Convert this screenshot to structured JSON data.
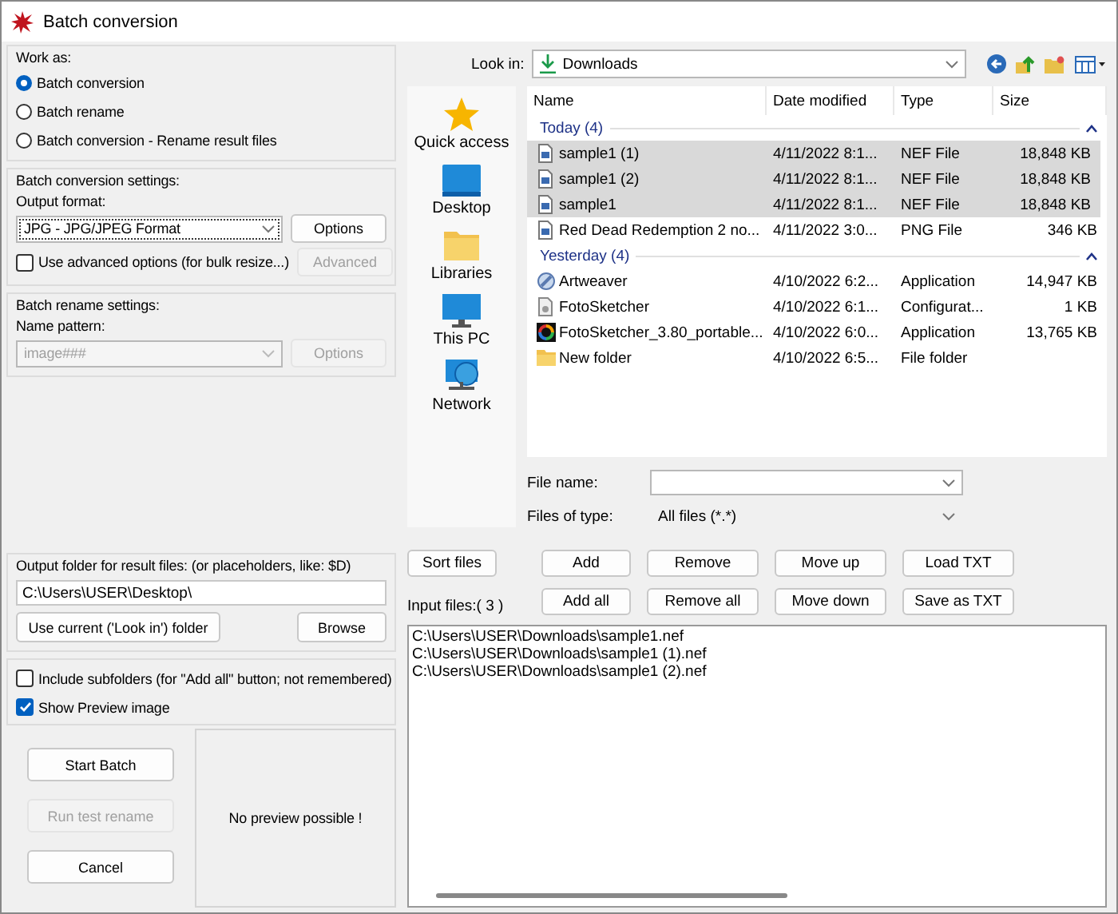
{
  "window": {
    "title": "Batch conversion"
  },
  "work_as": {
    "title": "Work as:",
    "options": [
      {
        "label": "Batch conversion",
        "selected": true
      },
      {
        "label": "Batch rename",
        "selected": false
      },
      {
        "label": "Batch conversion - Rename result files",
        "selected": false
      }
    ]
  },
  "conversion_settings": {
    "title": "Batch conversion settings:",
    "format_label": "Output format:",
    "format": "JPG - JPG/JPEG Format",
    "options_button": {
      "label": "Options",
      "disabled": false
    },
    "advanced_checkbox": {
      "label": "Use advanced options (for bulk resize...)",
      "checked": false
    },
    "advanced_button": {
      "label": "Advanced",
      "disabled": true
    }
  },
  "rename_settings": {
    "title": "Batch rename settings:",
    "pattern_label": "Name pattern:",
    "pattern": {
      "value": "image###",
      "disabled": true
    },
    "options_button": {
      "label": "Options",
      "disabled": true
    }
  },
  "output_folder": {
    "title": "Output folder for result files: (or placeholders, like: $D)",
    "value": "C:\\Users\\USER\\Desktop\\",
    "use_current_button": "Use current ('Look in') folder",
    "browse_button": "Browse"
  },
  "checkboxes": [
    {
      "label": "Include subfolders (for \"Add all\" button; not remembered)",
      "checked": false
    },
    {
      "label": "Show Preview image",
      "checked": true
    }
  ],
  "actions": [
    {
      "label": "Start Batch",
      "disabled": false
    },
    {
      "label": "Run test rename",
      "disabled": true
    },
    {
      "label": "Cancel",
      "disabled": false
    }
  ],
  "preview": {
    "text": "No preview possible !"
  },
  "file_browser": {
    "look_in_label": "Look in:",
    "look_in": "Downloads",
    "places": [
      {
        "label": "Quick access",
        "kind": "star"
      },
      {
        "label": "Desktop",
        "kind": "desktop"
      },
      {
        "label": "Libraries",
        "kind": "folder"
      },
      {
        "label": "This PC",
        "kind": "monitor"
      },
      {
        "label": "Network",
        "kind": "network"
      }
    ],
    "columns": [
      "Name",
      "Date modified",
      "Type",
      "Size"
    ],
    "groups": [
      {
        "title": "Today (4)",
        "expanded": true,
        "rows": [
          {
            "kind": "document",
            "name": "sample1 (1)",
            "date": "4/11/2022 8:1...",
            "type": "NEF File",
            "size": "18,848 KB",
            "selected": true
          },
          {
            "kind": "document",
            "name": "sample1 (2)",
            "date": "4/11/2022 8:1...",
            "type": "NEF File",
            "size": "18,848 KB",
            "selected": true
          },
          {
            "kind": "document",
            "name": "sample1",
            "date": "4/11/2022 8:1...",
            "type": "NEF File",
            "size": "18,848 KB",
            "selected": true
          },
          {
            "kind": "document",
            "name": "Red Dead Redemption 2 no...",
            "date": "4/11/2022 3:0...",
            "type": "PNG File",
            "size": "346 KB",
            "selected": false
          }
        ]
      },
      {
        "title": "Yesterday (4)",
        "expanded": true,
        "rows": [
          {
            "kind": "brush",
            "name": "Artweaver",
            "date": "4/10/2022 6:2...",
            "type": "Application",
            "size": "14,947 KB",
            "selected": false
          },
          {
            "kind": "settings",
            "name": "FotoSketcher",
            "date": "4/10/2022 6:1...",
            "type": "Configurat...",
            "size": "1 KB",
            "selected": false
          },
          {
            "kind": "swirl",
            "name": "FotoSketcher_3.80_portable...",
            "date": "4/10/2022 6:0...",
            "type": "Application",
            "size": "13,765 KB",
            "selected": false
          },
          {
            "kind": "folder",
            "name": "New folder",
            "date": "4/10/2022 6:5...",
            "type": "File folder",
            "selected": false
          }
        ]
      }
    ],
    "file_name_label": "File name:",
    "files_of_type_label": "Files of type:",
    "files_of_type": "All files (*.*)"
  },
  "sort_button": "Sort files",
  "list_buttons": [
    [
      "Add",
      "Remove",
      "Move up",
      "Load TXT"
    ],
    [
      "Add all",
      "Remove all",
      "Move down",
      "Save as TXT"
    ]
  ],
  "input_files_label": "Input files:( 3 )",
  "input_files": [
    "C:\\Users\\USER\\Downloads\\sample1.nef",
    "C:\\Users\\USER\\Downloads\\sample1 (1).nef",
    "C:\\Users\\USER\\Downloads\\sample1 (2).nef"
  ]
}
